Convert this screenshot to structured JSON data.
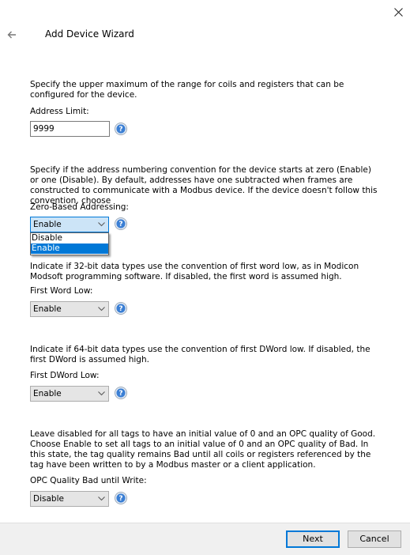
{
  "window": {
    "title": "Add Device Wizard",
    "back_icon": "arrow-left-icon",
    "close_icon": "close-icon"
  },
  "sections": {
    "address_limit": {
      "description": "Specify the upper maximum of the range for coils and registers that can be configured for the device.",
      "label": "Address Limit:",
      "value": "9999",
      "help_icon": "help-icon"
    },
    "zero_based": {
      "description": "Specify if the address numbering convention for the device starts at zero (Enable) or one (Disable). By default, addresses have one subtracted when frames are constructed to communicate with a Modbus device. If the device doesn't follow this convention, choose",
      "label": "Zero-Based Addressing:",
      "value": "Enable",
      "options": [
        "Disable",
        "Enable"
      ],
      "selected_option": "Enable",
      "expanded": true,
      "help_icon": "help-icon"
    },
    "first_word_low": {
      "description": "Indicate if 32-bit data types use the convention of first word low, as in Modicon Modsoft programming software. If disabled, the first word is assumed high.",
      "label": "First Word Low:",
      "value": "Enable",
      "help_icon": "help-icon"
    },
    "first_dword_low": {
      "description": "Indicate if 64-bit data types use the convention of first DWord low. If disabled, the first DWord is assumed high.",
      "label": "First DWord Low:",
      "value": "Enable",
      "help_icon": "help-icon"
    },
    "opc_quality": {
      "description": "Leave disabled for all tags to have an initial value of 0 and an OPC quality of Good. Choose Enable to set all tags to an initial value of 0 and an OPC quality of Bad. In this state, the tag quality remains Bad until all coils or registers referenced by the tag have been written to by a Modbus master or a client application.",
      "label": "OPC Quality Bad until Write:",
      "value": "Disable",
      "help_icon": "help-icon"
    }
  },
  "footer": {
    "next_label": "Next",
    "cancel_label": "Cancel"
  },
  "colors": {
    "accent": "#0078d7",
    "footer_bg": "#f0f0f0",
    "combo_bg": "#e5e5e5",
    "combo_open_bg": "#cce4f7",
    "help_icon": "#3b7fd4"
  }
}
